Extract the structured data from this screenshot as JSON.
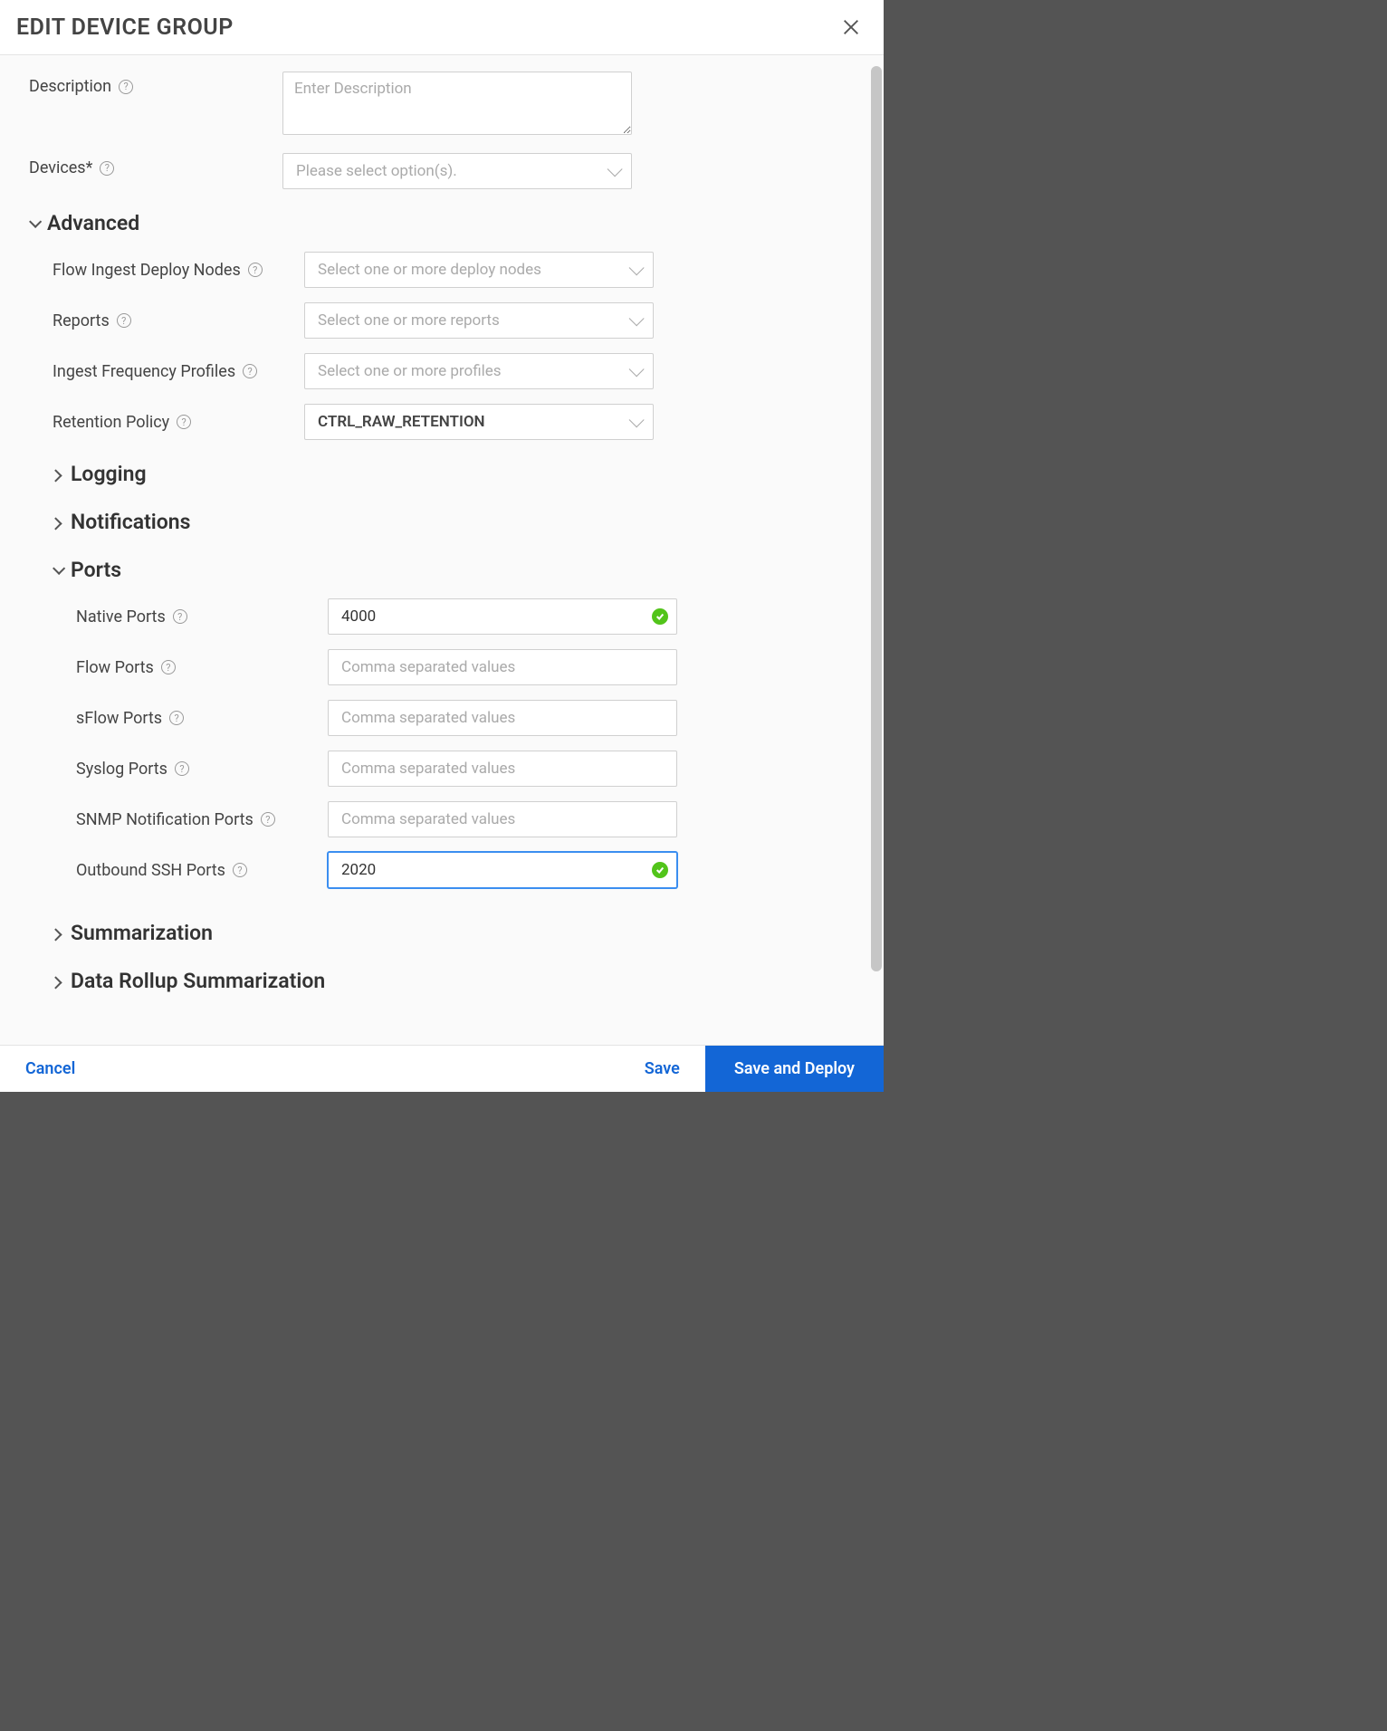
{
  "modal": {
    "title": "EDIT DEVICE GROUP"
  },
  "form": {
    "description": {
      "label": "Description",
      "placeholder": "Enter Description",
      "value": ""
    },
    "devices": {
      "label": "Devices*",
      "placeholder": "Please select option(s)."
    }
  },
  "sections": {
    "advanced": {
      "title": "Advanced",
      "expanded": true
    },
    "logging": {
      "title": "Logging",
      "expanded": false
    },
    "notifications": {
      "title": "Notifications",
      "expanded": false
    },
    "ports": {
      "title": "Ports",
      "expanded": true
    },
    "summarization": {
      "title": "Summarization",
      "expanded": false
    },
    "data_rollup": {
      "title": "Data Rollup Summarization",
      "expanded": false
    }
  },
  "advanced": {
    "flow_ingest_deploy_nodes": {
      "label": "Flow Ingest Deploy Nodes",
      "placeholder": "Select one or more deploy nodes"
    },
    "reports": {
      "label": "Reports",
      "placeholder": "Select one or more reports"
    },
    "ingest_frequency_profiles": {
      "label": "Ingest Frequency Profiles",
      "placeholder": "Select one or more profiles"
    },
    "retention_policy": {
      "label": "Retention Policy",
      "value": "CTRL_RAW_RETENTION"
    }
  },
  "ports": {
    "native": {
      "label": "Native Ports",
      "value": "4000",
      "valid": true
    },
    "flow": {
      "label": "Flow Ports",
      "placeholder": "Comma separated values",
      "value": ""
    },
    "sflow": {
      "label": "sFlow Ports",
      "placeholder": "Comma separated values",
      "value": ""
    },
    "syslog": {
      "label": "Syslog Ports",
      "placeholder": "Comma separated values",
      "value": ""
    },
    "snmp": {
      "label": "SNMP Notification Ports",
      "placeholder": "Comma separated values",
      "value": ""
    },
    "outbound_ssh": {
      "label": "Outbound SSH Ports",
      "value": "2020",
      "valid": true
    }
  },
  "footer": {
    "cancel": "Cancel",
    "save": "Save",
    "save_deploy": "Save and Deploy"
  }
}
